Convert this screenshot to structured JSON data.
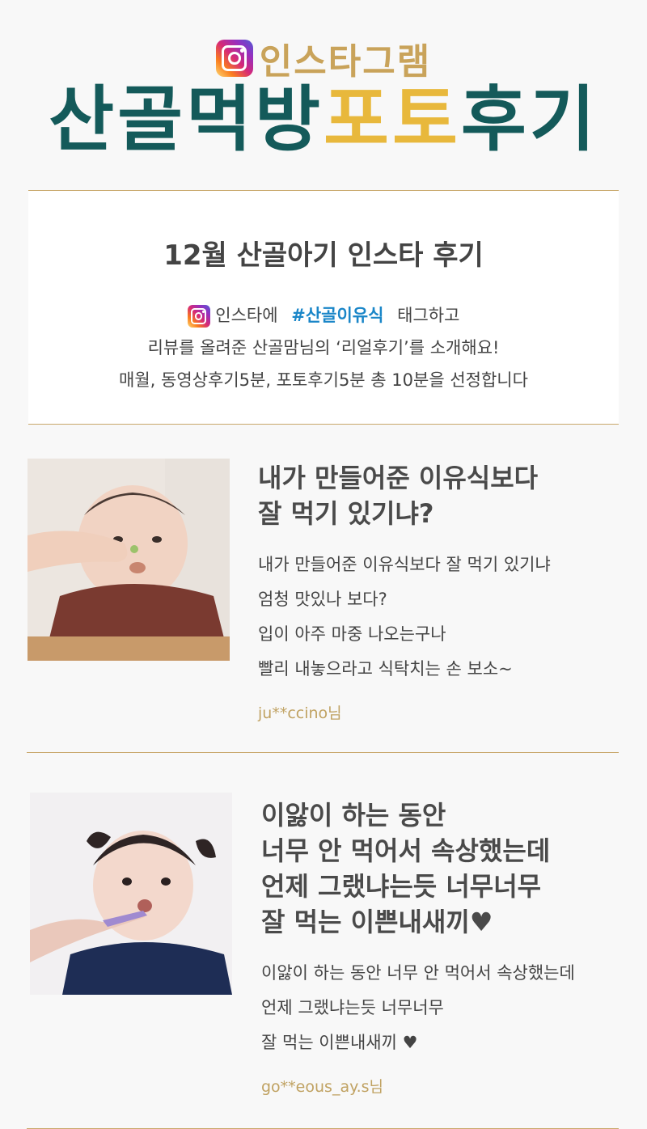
{
  "header": {
    "brand_text": "인스타그램",
    "title_part1": "산골먹방",
    "title_part2": "포토",
    "title_part3": "후기"
  },
  "intro": {
    "heading": "12월 산골아기 인스타 후기",
    "line1_prefix": "인스타에",
    "hashtag": "#산골이유식",
    "line1_suffix": "태그하고",
    "line2": "리뷰를 올려준 산골맘님의 ‘리얼후기’를 소개해요!",
    "line3": "매월, 동영상후기5분, 포토후기5분 총 10분을 선정합니다"
  },
  "reviews": [
    {
      "title_lines": [
        "내가 만들어준 이유식보다",
        "잘 먹기 있기냐?"
      ],
      "body_lines": [
        "내가 만들어준 이유식보다 잘 먹기 있기냐",
        "엄청 맛있나 보다?",
        "입이 아주 마중 나오는구나",
        "빨리 내놓으라고 식탁치는 손 보소~"
      ],
      "author": "ju**ccino님"
    },
    {
      "title_lines": [
        "이앓이 하는 동안",
        "너무 안 먹어서 속상했는데",
        "언제 그랬냐는듯 너무너무",
        "잘 먹는 이쁜내새끼♥"
      ],
      "body_lines": [
        "이앓이 하는 동안 너무 안 먹어서 속상했는데",
        "언제 그랬냐는듯 너무너무",
        "잘 먹는 이쁜내새끼 ♥"
      ],
      "author": "go**eous_ay.s님"
    }
  ],
  "colors": {
    "accent_gold": "#c9a35a",
    "title_teal": "#145a5a",
    "title_yellow": "#e8b83c",
    "hashtag_blue": "#1a86c8"
  },
  "icons": {
    "brand_icon": "instagram-icon",
    "intro_icon": "instagram-icon"
  }
}
